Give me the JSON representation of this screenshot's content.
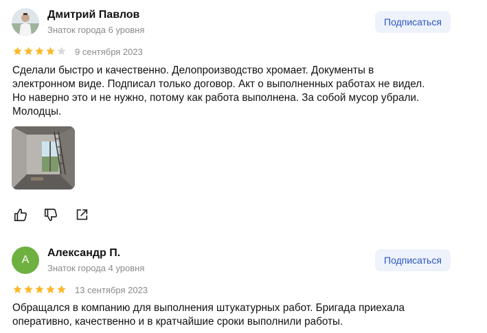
{
  "reviews": [
    {
      "author_name": "Дмитрий Павлов",
      "author_level": "Знаток города 6 уровня",
      "subscribe_label": "Подписаться",
      "rating": 4,
      "rating_max": 5,
      "date": "9 сентября 2023",
      "text_lines": [
        "Сделали быстро и качественно. Делопроизводство хромает. Документы в",
        "электронном виде. Подписал только договор. Акт о выполненных работах не видел.",
        "Но наверно это и не нужно, потому как работа выполнена. За собой мусор убрали.",
        "Молодцы."
      ],
      "has_photo": true
    },
    {
      "author_name": "Александр П.",
      "author_initial": "А",
      "author_level": "Знаток города 4 уровня",
      "subscribe_label": "Подписаться",
      "rating": 5,
      "rating_max": 5,
      "date": "13 сентября 2023",
      "text_lines": [
        "Обращался в компанию для выполнения штукатурных работ. Бригада приехала",
        "оперативно, качественно и в кратчайшие сроки выполнили работы."
      ]
    }
  ],
  "icons": {
    "like": "thumbs-up-icon",
    "dislike": "thumbs-down-icon",
    "share": "share-icon",
    "star": "star-icon"
  },
  "colors": {
    "star_filled": "#fbb829",
    "star_empty": "#d9d9d9",
    "subscribe_bg": "#eef2fa",
    "subscribe_text": "#2a55c4",
    "initial_avatar": "#6fb141",
    "secondary_text": "#8a8a8a"
  }
}
